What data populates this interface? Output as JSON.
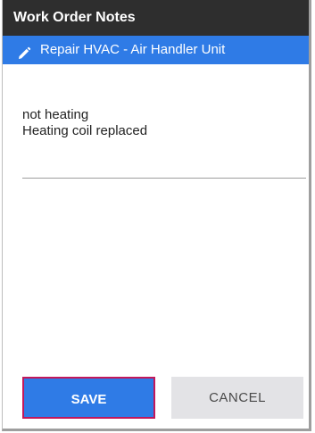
{
  "dialog": {
    "title": "Work Order Notes",
    "subheader": {
      "icon": "pencil-icon",
      "label": "Repair HVAC - Air Handler Unit"
    },
    "notes": {
      "value": "not heating\nHeating coil replaced"
    },
    "buttons": {
      "save_label": "SAVE",
      "cancel_label": "CANCEL"
    }
  },
  "colors": {
    "title_bar": "#2e2e2e",
    "accent": "#2f7be6",
    "save_border": "#c2185b",
    "cancel_bg": "#e3e3e6"
  }
}
